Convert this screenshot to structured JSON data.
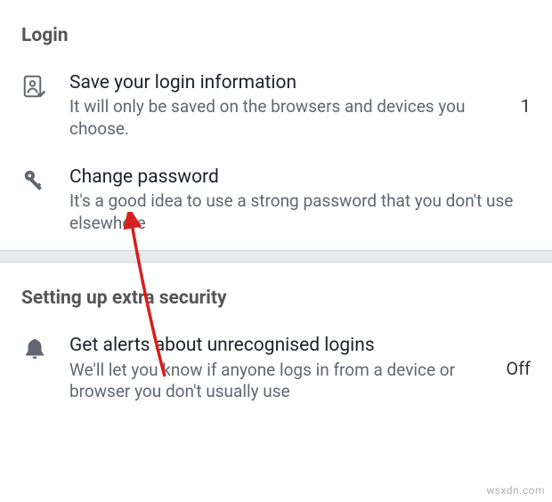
{
  "sections": {
    "login": {
      "header": "Login",
      "items": [
        {
          "title": "Save your login information",
          "subtitle": "It will only be saved on the browsers and devices you choose.",
          "value": "1"
        },
        {
          "title": "Change password",
          "subtitle": "It's a good idea to use a strong password that you don't use elsewhere",
          "value": ""
        }
      ]
    },
    "extra_security": {
      "header": "Setting up extra security",
      "items": [
        {
          "title": "Get alerts about unrecognised logins",
          "subtitle": "We'll let you know if anyone logs in from a device or browser you don't usually use",
          "value": "Off"
        }
      ]
    }
  },
  "watermark": "wsxdn.com"
}
